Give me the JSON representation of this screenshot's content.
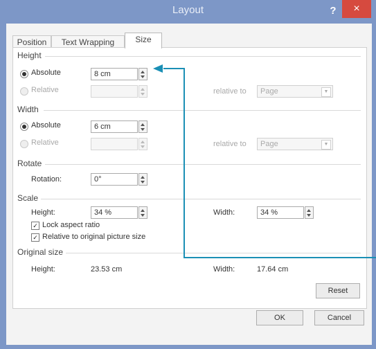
{
  "dialog": {
    "title": "Layout",
    "help": "?",
    "close": "×"
  },
  "tabs": [
    {
      "label": "Position",
      "active": false
    },
    {
      "label": "Text Wrapping",
      "active": false
    },
    {
      "label": "Size",
      "active": true
    }
  ],
  "height": {
    "section": "Height",
    "absolute_label": "Absolute",
    "absolute_value": "8 cm",
    "relative_label": "Relative",
    "relative_value": "",
    "relative_to_label": "relative to",
    "relative_to_value": "Page"
  },
  "width": {
    "section": "Width",
    "absolute_label": "Absolute",
    "absolute_value": "6 cm",
    "relative_label": "Relative",
    "relative_value": "",
    "relative_to_label": "relative to",
    "relative_to_value": "Page"
  },
  "rotate": {
    "section": "Rotate",
    "rotation_label": "Rotation:",
    "rotation_value": "0°"
  },
  "scale": {
    "section": "Scale",
    "height_label": "Height:",
    "height_value": "34 %",
    "width_label": "Width:",
    "width_value": "34 %",
    "lock_label": "Lock aspect ratio",
    "lock_checked": true,
    "relative_label": "Relative to original picture size",
    "relative_checked": true
  },
  "original": {
    "section": "Original size",
    "height_label": "Height:",
    "height_value": "23.53 cm",
    "width_label": "Width:",
    "width_value": "17.64 cm"
  },
  "buttons": {
    "reset": "Reset",
    "ok": "OK",
    "cancel": "Cancel"
  },
  "colors": {
    "frame": "#7d97c7",
    "close": "#d64a3f",
    "annotation_arrow": "#1a8fb5"
  }
}
